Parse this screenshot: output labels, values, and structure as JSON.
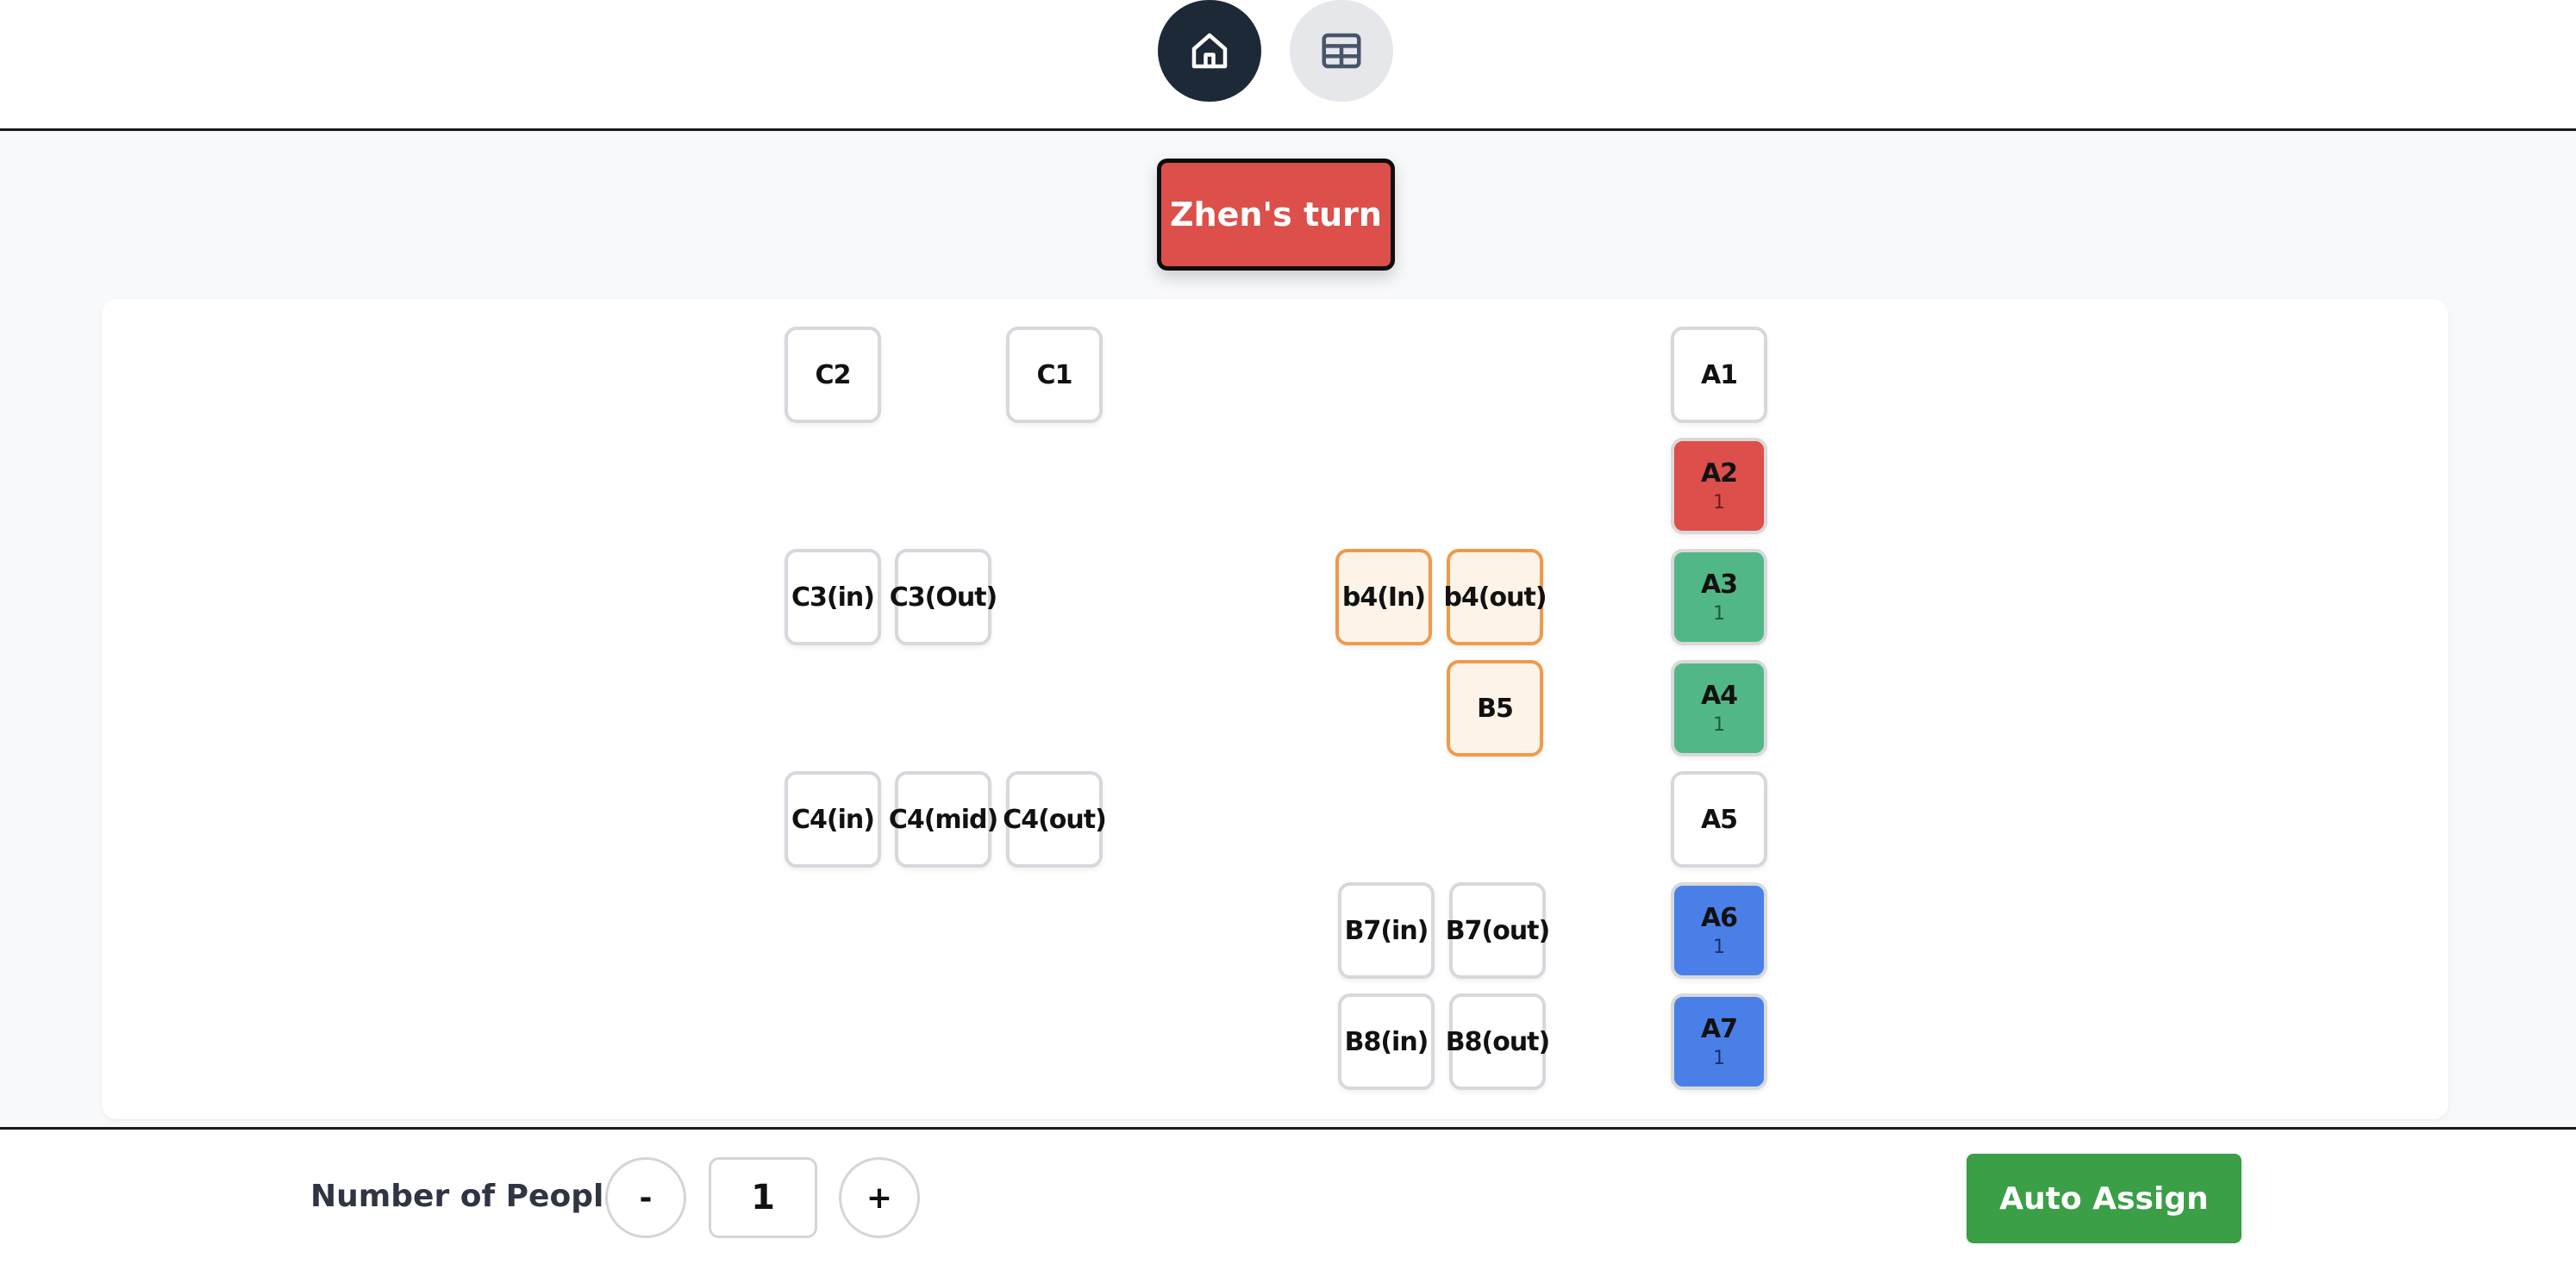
{
  "nav": {
    "home_icon": "home-icon",
    "table_icon": "table-grid-icon"
  },
  "turn": {
    "label": "Zhen's turn"
  },
  "seats": {
    "C2": {
      "label": "C2"
    },
    "C1": {
      "label": "C1"
    },
    "A1": {
      "label": "A1"
    },
    "A2": {
      "label": "A2",
      "count": "1",
      "status": "red"
    },
    "C3in": {
      "label": "C3(in)"
    },
    "C3out": {
      "label": "C3(Out)"
    },
    "b4in": {
      "label": "b4(In)",
      "status": "orange"
    },
    "b4out": {
      "label": "b4(out)",
      "status": "orange"
    },
    "A3": {
      "label": "A3",
      "count": "1",
      "status": "green"
    },
    "B5": {
      "label": "B5",
      "status": "orange"
    },
    "A4": {
      "label": "A4",
      "count": "1",
      "status": "green"
    },
    "C4in": {
      "label": "C4(in)"
    },
    "C4mid": {
      "label": "C4(mid)"
    },
    "C4out": {
      "label": "C4(out)"
    },
    "A5": {
      "label": "A5"
    },
    "B7in": {
      "label": "B7(in)"
    },
    "B7out": {
      "label": "B7(out)"
    },
    "A6": {
      "label": "A6",
      "count": "1",
      "status": "blue"
    },
    "B8in": {
      "label": "B8(in)"
    },
    "B8out": {
      "label": "B8(out)"
    },
    "A7": {
      "label": "A7",
      "count": "1",
      "status": "blue"
    }
  },
  "footer": {
    "people_label": "Number of People",
    "minus_label": "-",
    "people_value": "1",
    "plus_label": "+",
    "auto_assign_label": "Auto Assign"
  },
  "colors": {
    "turn_red": "#dc4f4a",
    "assigned_green": "#52b786",
    "assigned_blue": "#4a7fe8",
    "selected_orange": "#ef9a4a",
    "auto_assign_green": "#3b9f48",
    "nav_dark": "#1e2937"
  }
}
